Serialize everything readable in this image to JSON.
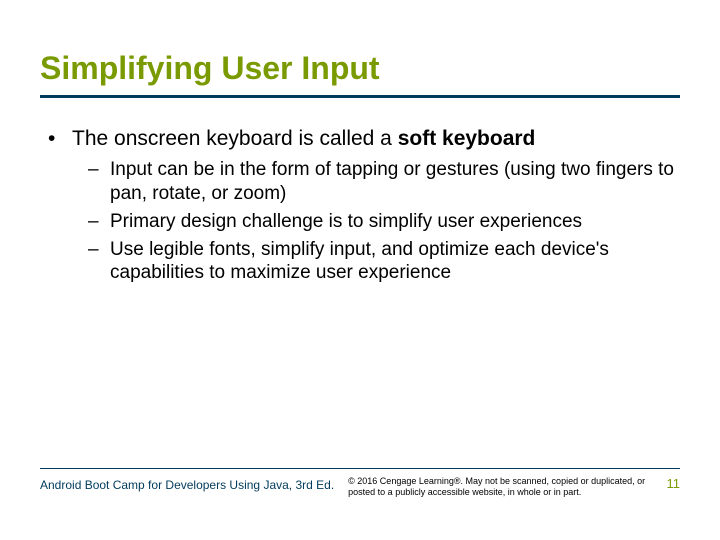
{
  "title": "Simplifying User Input",
  "body": {
    "lvl1_prefix": "The onscreen keyboard is called a ",
    "lvl1_bold": "soft keyboard",
    "sub": [
      "Input can be in the form of tapping or gestures (using two fingers to pan, rotate, or zoom)",
      "Primary design challenge is to simplify user experiences",
      "Use legible fonts, simplify input, and optimize each device's capabilities to maximize user experience"
    ]
  },
  "footer": {
    "left": "Android Boot Camp for Developers Using Java, 3rd Ed.",
    "mid": "© 2016 Cengage Learning®. May not be scanned, copied or duplicated, or posted to a publicly accessible website, in whole or in part.",
    "page": "11"
  },
  "glyphs": {
    "bullet": "•",
    "dash": "–"
  }
}
